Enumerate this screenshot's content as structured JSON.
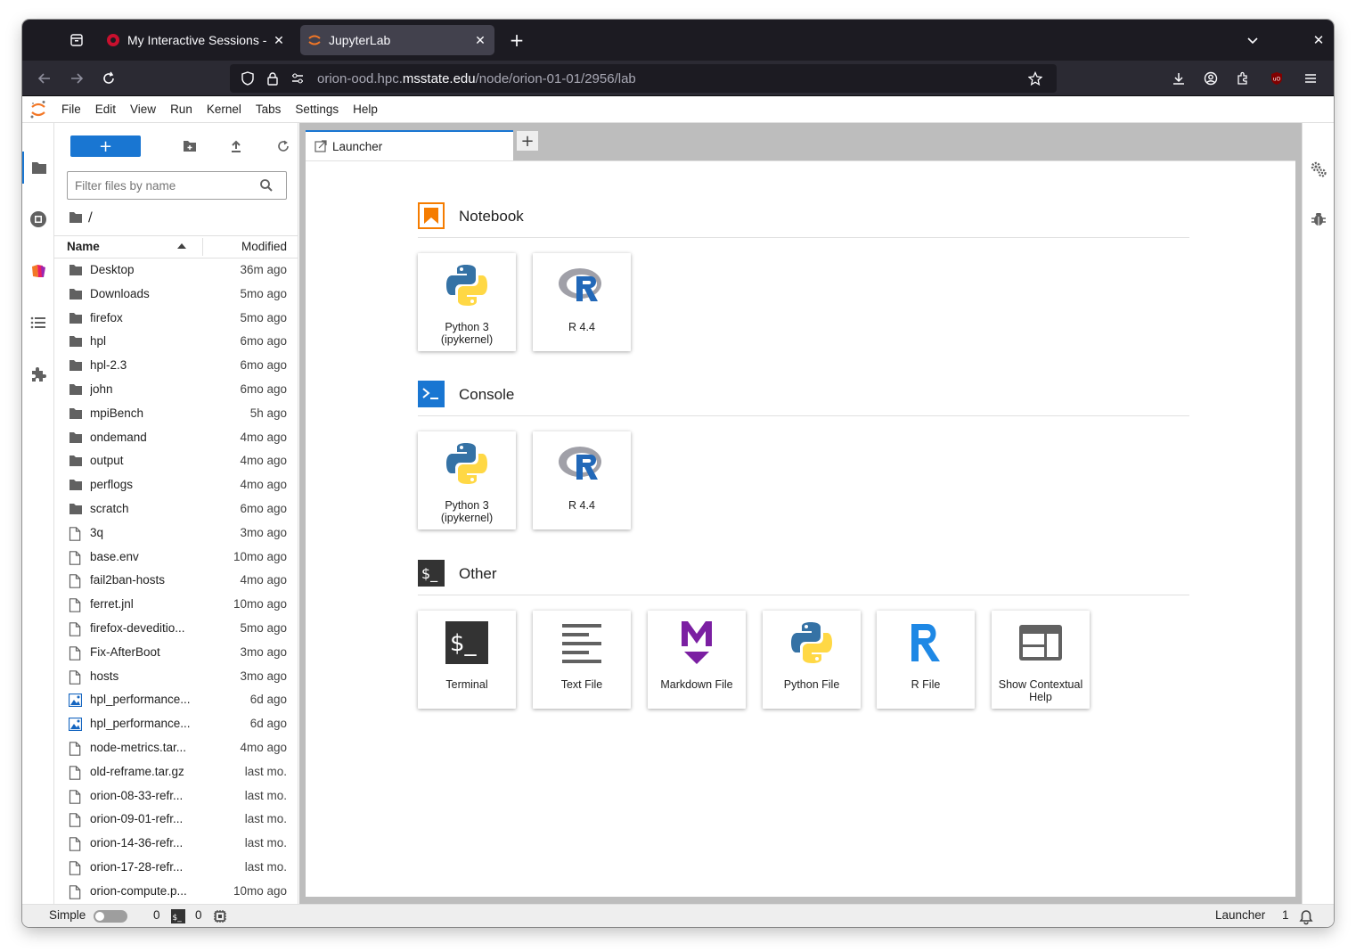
{
  "browser": {
    "tabs": [
      {
        "title": "My Interactive Sessions - |",
        "active": false
      },
      {
        "title": "JupyterLab",
        "active": true
      }
    ],
    "url_prefix": "orion-ood.hpc.",
    "url_host": "msstate.edu",
    "url_path": "/node/orion-01-01/2956/lab"
  },
  "menu": {
    "items": [
      "File",
      "Edit",
      "View",
      "Run",
      "Kernel",
      "Tabs",
      "Settings",
      "Help"
    ]
  },
  "filebrowser": {
    "filter_placeholder": "Filter files by name",
    "breadcrumb": "/",
    "col_name": "Name",
    "col_modified": "Modified",
    "rows": [
      {
        "name": "Desktop",
        "modified": "36m ago",
        "type": "folder"
      },
      {
        "name": "Downloads",
        "modified": "5mo ago",
        "type": "folder"
      },
      {
        "name": "firefox",
        "modified": "5mo ago",
        "type": "folder"
      },
      {
        "name": "hpl",
        "modified": "6mo ago",
        "type": "folder"
      },
      {
        "name": "hpl-2.3",
        "modified": "6mo ago",
        "type": "folder"
      },
      {
        "name": "john",
        "modified": "6mo ago",
        "type": "folder"
      },
      {
        "name": "mpiBench",
        "modified": "5h ago",
        "type": "folder"
      },
      {
        "name": "ondemand",
        "modified": "4mo ago",
        "type": "folder"
      },
      {
        "name": "output",
        "modified": "4mo ago",
        "type": "folder"
      },
      {
        "name": "perflogs",
        "modified": "4mo ago",
        "type": "folder"
      },
      {
        "name": "scratch",
        "modified": "6mo ago",
        "type": "folder"
      },
      {
        "name": "3q",
        "modified": "3mo ago",
        "type": "file"
      },
      {
        "name": "base.env",
        "modified": "10mo ago",
        "type": "file"
      },
      {
        "name": "fail2ban-hosts",
        "modified": "4mo ago",
        "type": "file"
      },
      {
        "name": "ferret.jnl",
        "modified": "10mo ago",
        "type": "file"
      },
      {
        "name": "firefox-deveditio...",
        "modified": "5mo ago",
        "type": "file"
      },
      {
        "name": "Fix-AfterBoot",
        "modified": "3mo ago",
        "type": "file"
      },
      {
        "name": "hosts",
        "modified": "3mo ago",
        "type": "file"
      },
      {
        "name": "hpl_performance...",
        "modified": "6d ago",
        "type": "image"
      },
      {
        "name": "hpl_performance...",
        "modified": "6d ago",
        "type": "image"
      },
      {
        "name": "node-metrics.tar...",
        "modified": "4mo ago",
        "type": "file"
      },
      {
        "name": "old-reframe.tar.gz",
        "modified": "last mo.",
        "type": "file"
      },
      {
        "name": "orion-08-33-refr...",
        "modified": "last mo.",
        "type": "file"
      },
      {
        "name": "orion-09-01-refr...",
        "modified": "last mo.",
        "type": "file"
      },
      {
        "name": "orion-14-36-refr...",
        "modified": "last mo.",
        "type": "file"
      },
      {
        "name": "orion-17-28-refr...",
        "modified": "last mo.",
        "type": "file"
      },
      {
        "name": "orion-compute.p...",
        "modified": "10mo ago",
        "type": "file"
      }
    ]
  },
  "launcher": {
    "tab_title": "Launcher",
    "sections": [
      {
        "title": "Notebook",
        "cards": [
          {
            "label": "Python 3\n(ipykernel)",
            "icon": "python-icon"
          },
          {
            "label": "R 4.4",
            "icon": "r-icon"
          }
        ]
      },
      {
        "title": "Console",
        "cards": [
          {
            "label": "Python 3\n(ipykernel)",
            "icon": "python-icon"
          },
          {
            "label": "R 4.4",
            "icon": "r-icon"
          }
        ]
      },
      {
        "title": "Other",
        "cards": [
          {
            "label": "Terminal",
            "icon": "terminal-icon"
          },
          {
            "label": "Text File",
            "icon": "text-file-icon"
          },
          {
            "label": "Markdown File",
            "icon": "markdown-icon"
          },
          {
            "label": "Python File",
            "icon": "python-icon"
          },
          {
            "label": "R File",
            "icon": "r-file-icon"
          },
          {
            "label": "Show Contextual Help",
            "icon": "contextual-help-icon"
          }
        ]
      }
    ]
  },
  "statusbar": {
    "mode_label": "Simple",
    "kernels_count": "0",
    "terminals_count": "0",
    "active_label": "Launcher",
    "notifications_count": "1"
  },
  "colors": {
    "accent": "#1976d2",
    "notebook_orange": "#f57c00",
    "console_blue": "#1976d2",
    "markdown_purple": "#7b1fa2"
  }
}
